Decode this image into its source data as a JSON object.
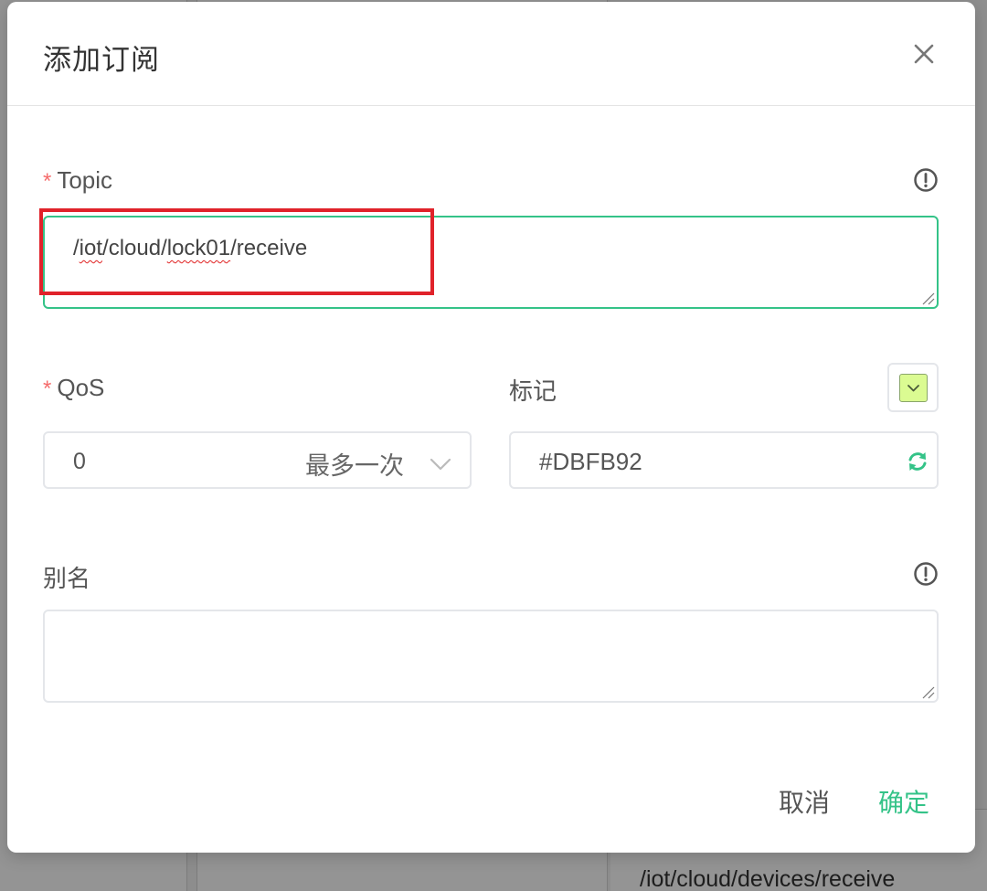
{
  "background": {
    "message_topic": "/iot/cloud/devices/receive"
  },
  "dialog": {
    "title": "添加订阅",
    "close_icon": "close-icon",
    "topic": {
      "required_mark": "*",
      "label": "Topic",
      "info_icon": "info-circle-icon",
      "value_parts": [
        "/",
        "iot",
        "/cloud/",
        "lock01",
        "/receive"
      ]
    },
    "qos": {
      "required_mark": "*",
      "label": "QoS",
      "value": "0",
      "description": "最多一次",
      "chevron_icon": "chevron-down-icon"
    },
    "color": {
      "label": "标记",
      "value": "#DBFB92",
      "swatch_color": "#DBFB92",
      "refresh_icon": "refresh-icon"
    },
    "alias": {
      "label": "别名",
      "info_icon": "info-circle-icon",
      "value": ""
    },
    "buttons": {
      "cancel": "取消",
      "confirm": "确定"
    }
  },
  "colors": {
    "accent": "#34c388",
    "required": "#f56c6c",
    "highlight": "#e0222a"
  }
}
